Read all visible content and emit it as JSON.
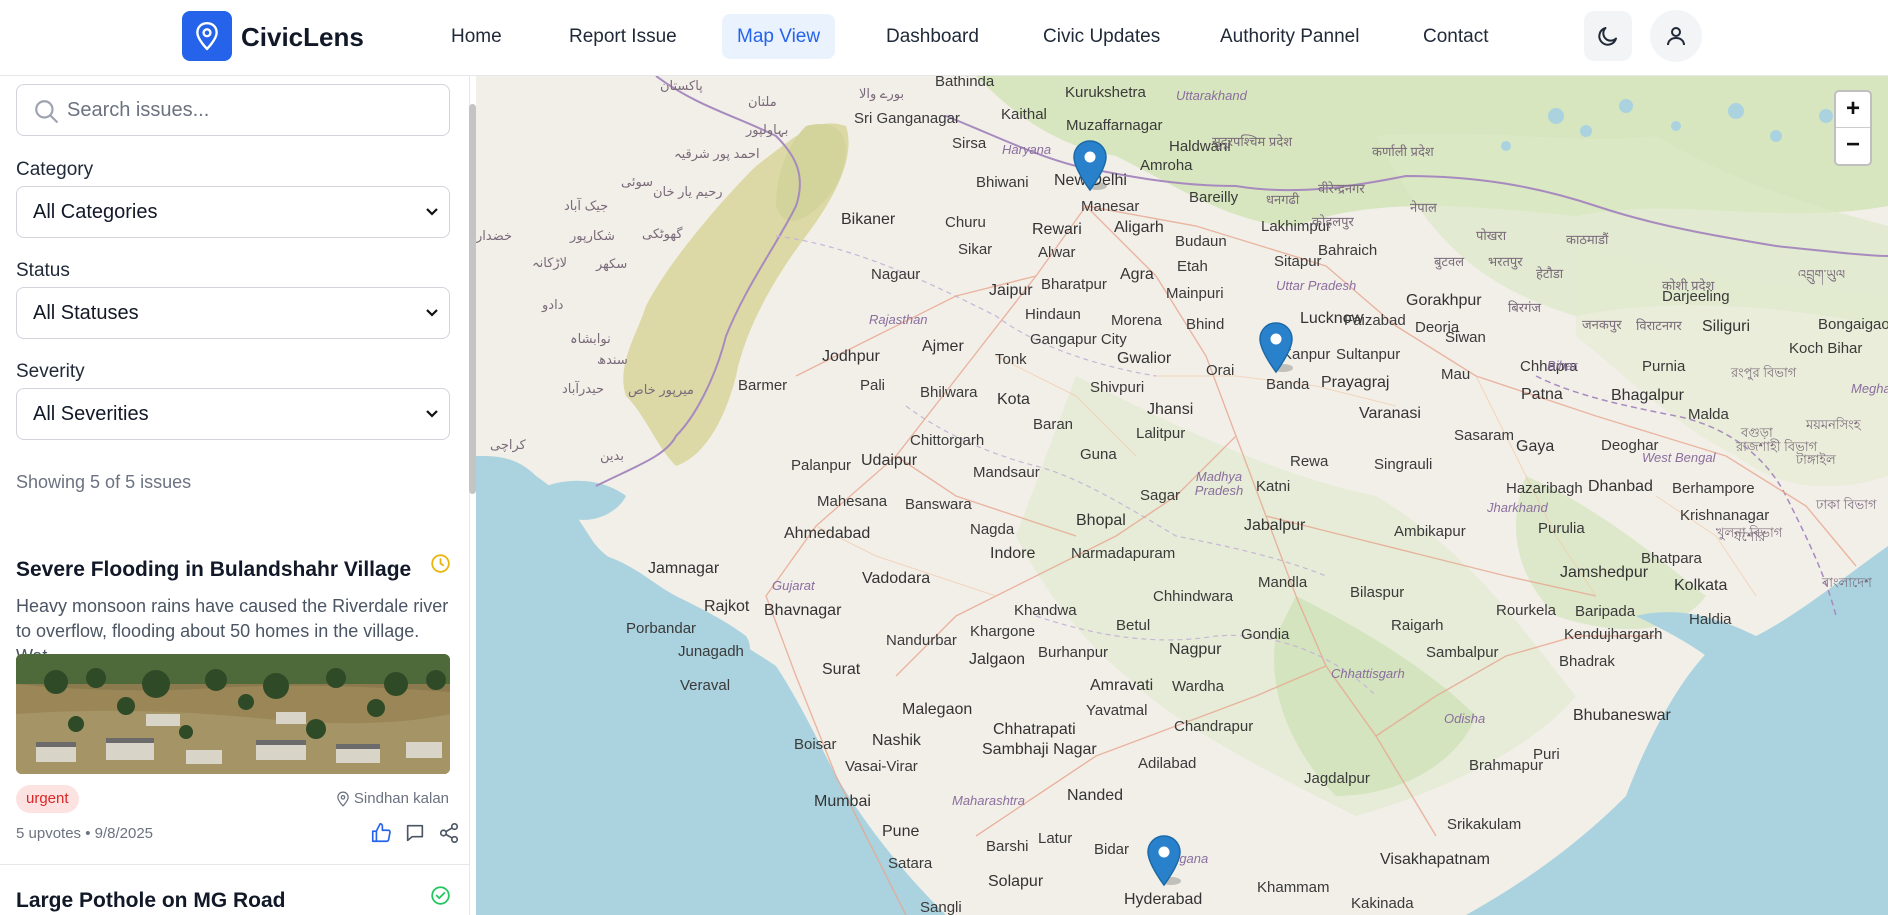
{
  "app": {
    "name": "CivicLens"
  },
  "nav": {
    "items": [
      {
        "label": "Home"
      },
      {
        "label": "Report Issue"
      },
      {
        "label": "Map View"
      },
      {
        "label": "Dashboard"
      },
      {
        "label": "Civic Updates"
      },
      {
        "label": "Authority Pannel"
      },
      {
        "label": "Contact"
      }
    ],
    "active": "Map View"
  },
  "header": {
    "theme_icon": "moon-icon",
    "profile_icon": "user-icon"
  },
  "filters": {
    "search_placeholder": "Search issues...",
    "category": {
      "label": "Category",
      "value": "All Categories"
    },
    "status": {
      "label": "Status",
      "value": "All Statuses"
    },
    "severity": {
      "label": "Severity",
      "value": "All Severities"
    }
  },
  "results": {
    "count_text": "Showing 5 of 5 issues"
  },
  "issues": [
    {
      "title": "Severe Flooding in Bulandshahr Village",
      "status_icon": "clock-icon",
      "status_color": "#eab308",
      "description": "Heavy monsoon rains have caused the Riverdale river to overflow, flooding about 50 homes in the village. Wat...",
      "severity": "urgent",
      "location": "Sindhan kalan",
      "meta": "5 upvotes • 9/8/2025"
    },
    {
      "title": "Large Pothole on MG Road",
      "status_icon": "check-circle-icon",
      "status_color": "#22c55e"
    }
  ],
  "map": {
    "zoom_in": "+",
    "zoom_out": "−",
    "labels": {
      "pakistan": "پاکستان",
      "kurukshetra": "Kurukshetra",
      "uttarakhand": "Uttarakhand",
      "bathinda": "Bathinda",
      "muzaffarnagar": "Muzaffarnagar",
      "multan": "ملتان",
      "sriganganagar": "Sri Ganganagar",
      "kaithal": "Kaithal",
      "haryana": "Haryana",
      "haldwani": "Haldwani",
      "bahawalpur": "بہاولپور",
      "sirsa": "Sirsa",
      "amroha": "Amroha",
      "bhiwani": "Bhiwani",
      "newdelhi": "New Delhi",
      "bareilly": "Bareilly",
      "manesar": "Manesar",
      "bikaner": "Bikaner",
      "churu": "Churu",
      "rewari": "Rewari",
      "aligarh": "Aligarh",
      "lakhimpur": "Lakhimpur",
      "bahraich": "Bahraich",
      "nepal": "नेपाल",
      "kathmandu": "काठमाडौं",
      "alwar": "Alwar",
      "budaun": "Budaun",
      "sikar": "Sikar",
      "etah": "Etah",
      "sitapur": "Sitapur",
      "nagaur": "Nagaur",
      "jaipur": "Jaipur",
      "bharatpur": "Bharatpur",
      "agra": "Agra",
      "mainpuri": "Mainpuri",
      "uttarpradesh": "Uttar Pradesh",
      "gorakhpur": "Gorakhpur",
      "darjeeling": "Darjeeling",
      "hindaun": "Hindaun",
      "lucknow": "Lucknow",
      "faizabad": "Faizabad",
      "deoria": "Deoria",
      "bongaigaon": "Bongaigaon",
      "rajasthan": "Rajasthan",
      "gangapurcity": "Gangapur City",
      "morena": "Morena",
      "bhind": "Bhind",
      "siliguri": "Siliguri",
      "jodhpur": "Jodhpur",
      "ajmer": "Ajmer",
      "tonk": "Tonk",
      "gwalior": "Gwalior",
      "kanpur": "Kanpur",
      "sultanpur": "Sultanpur",
      "siwan": "Siwan",
      "kochbihar": "Koch Bihar",
      "banda": "Banda",
      "orai": "Orai",
      "prayagraj": "Prayagraj",
      "chhapra": "Chhapra",
      "purnia": "Purnia",
      "barmer": "Barmer",
      "pali": "Pali",
      "bhilwara": "Bhilwara",
      "shivpuri": "Shivpuri",
      "mau": "Mau",
      "patna": "Patna",
      "bhagalpur": "Bhagalpur",
      "kota": "Kota",
      "jhansi": "Jhansi",
      "bihar": "Bihar",
      "varanasi": "Varanasi",
      "malda": "Malda",
      "lalitpur": "Lalitpur",
      "baran": "Baran",
      "chittorgarh": "Chittorgarh",
      "guna": "Guna",
      "rewa": "Rewa",
      "singrauli": "Singrauli",
      "sasaram": "Sasaram",
      "gaya": "Gaya",
      "deoghar": "Deoghar",
      "palanpur": "Palanpur",
      "udaipur": "Udaipur",
      "mandsaur": "Mandsaur",
      "westbengal": "West Bengal",
      "madhyapradesh": "Madhya Pradesh",
      "katni": "Katni",
      "hazaribagh": "Hazaribagh",
      "dhanbad": "Dhanbad",
      "berhampore": "Berhampore",
      "mahesana": "Mahesana",
      "banswara": "Banswara",
      "sagar": "Sagar",
      "jharkhand": "Jharkhand",
      "krishnanagar": "Krishnanagar",
      "ahmedabad": "Ahmedabad",
      "nagda": "Nagda",
      "bhopal": "Bhopal",
      "jabalpur": "Jabalpur",
      "ambikapur": "Ambikapur",
      "purulia": "Purulia",
      "indore": "Indore",
      "narmadapuram": "Narmadapuram",
      "bhatpara": "Bhatpara",
      "jamnagar": "Jamnagar",
      "mandla": "Mandla",
      "bilaspur": "Bilaspur",
      "jamshedpur": "Jamshedpur",
      "kolkata": "Kolkata",
      "gujarat": "Gujarat",
      "vadodara": "Vadodara",
      "rajkot": "Rajkot",
      "khandwa": "Khandwa",
      "chhindwara": "Chhindwara",
      "bhavnagar": "Bhavnagar",
      "betul": "Betul",
      "rourkela": "Rourkela",
      "baripada": "Baripada",
      "haldia": "Haldia",
      "porbandar": "Porbandar",
      "nandurbar": "Nandurbar",
      "khargone": "Khargone",
      "gondia": "Gondia",
      "raigarh": "Raigarh",
      "kendujhargarh": "Kendujhargarh",
      "junagadh": "Junagadh",
      "jalgaon": "Jalgaon",
      "burhanpur": "Burhanpur",
      "nagpur": "Nagpur",
      "sambalpur": "Sambalpur",
      "surat": "Surat",
      "chhattisgarh": "Chhattisgarh",
      "bhadrak": "Bhadrak",
      "veraval": "Veraval",
      "amravati": "Amravati",
      "wardha": "Wardha",
      "malegaon": "Malegaon",
      "yavatmal": "Yavatmal",
      "odisha": "Odisha",
      "bhubaneswar": "Bhubaneswar",
      "chhatrapati": "Chhatrapati",
      "sambhajinagar": "Sambhaji Nagar",
      "chandrapur": "Chandrapur",
      "nashik": "Nashik",
      "boisar": "Boisar",
      "puri": "Puri",
      "vasaivirar": "Vasai-Virar",
      "brahmapur": "Brahmapur",
      "adilabad": "Adilabad",
      "jagdalpur": "Jagdalpur",
      "mumbai": "Mumbai",
      "maharashtra": "Maharashtra",
      "nanded": "Nanded",
      "pune": "Pune",
      "srikakulam": "Srikakulam",
      "latur": "Latur",
      "barshi": "Barshi",
      "bidar": "Bidar",
      "telangana": "Telangana",
      "visakhapatnam": "Visakhapatnam",
      "satara": "Satara",
      "solapur": "Solapur",
      "khammam": "Khammam",
      "hyderabad": "Hyderabad",
      "kakinada": "Kakinada",
      "sangli": "Sangli",
      "karachi": "کراچی",
      "hyderabadpk": "حیدرآباد",
      "sukkur": "سکھر",
      "rahimyarkhan": "رحیم یار خان",
      "mirpurkhas": "میرپور خاص",
      "larkana": "لاڑکانہ",
      "sindh": "سندھ",
      "badin": "بدین",
      "jacobabad": "جیک آباد",
      "shikarpur": "شکارپور",
      "ghotki": "گھوٹکی",
      "sui": "سوئی",
      "khuzdar": "خضدار",
      "dadu": "دادو",
      "nawabshah": "نوابشاہ",
      "ahmadpur": "احمد پور شرقیہ",
      "burewala": "بورے والا",
      "bangladesh": "বাংলাদেশ",
      "dhaka": "ঢাকা বিভাগ",
      "rajshahi": "রাজশাহী বিভাগ",
      "bogura": "বগুড়া",
      "mymensingh": "ময়মনসিংহ",
      "jashore": "যশোর",
      "khulna": "খুলনা বিভাগ",
      "tangail": "টাঙ্গাইল",
      "rangpur": "রংপুর বিভাগ",
      "biratnagar": "विराटनगर",
      "birgunj": "बिरगंज",
      "janakpur": "जनकपुर",
      "pokhara": "पोखरा",
      "butwal": "बुटवल",
      "bharatpurnp": "भरतपुर",
      "hetauda": "हेटौडा",
      "kohalpur": "कोहलपुर",
      "dhangadhi": "धनगढी",
      "birendranagar": "वीरेन्द्रनगर",
      "karnali": "कर्णाली प्रदेश",
      "sudurpaschim": "सुदूरपश्चिम प्रदेश",
      "koshi": "कोशी प्रदेश",
      "bhutan": "འབྲུག་ཡུལ",
      "meghalaya": "Meghalaya"
    },
    "markers": [
      {
        "name": "New Delhi"
      },
      {
        "name": "Kanpur"
      },
      {
        "name": "Hyderabad"
      }
    ]
  }
}
